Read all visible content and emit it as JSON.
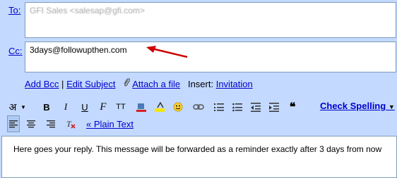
{
  "to": {
    "label": "To:",
    "value": "GFI Sales <salesap@gfi.com>"
  },
  "cc": {
    "label": "Cc:",
    "value": "3days@followupthen.com"
  },
  "links": {
    "add_bcc": "Add Bcc",
    "separator": "|",
    "edit_subject": "Edit Subject",
    "attach": "Attach a file",
    "insert_label": "Insert:",
    "invitation": "Invitation"
  },
  "toolbar": {
    "font_glyph": "अ",
    "bold": "B",
    "italic": "I",
    "underline": "U",
    "font": "F",
    "size": "TT",
    "check_spelling": "Check Spelling",
    "plain_text": "« Plain Text"
  },
  "body": {
    "text": "Here goes your reply. This message will be forwarded as a reminder exactly after 3 days from now"
  },
  "colors": {
    "background": "#c3d9ff",
    "link": "#0000cc",
    "arrow": "#cc0000"
  }
}
